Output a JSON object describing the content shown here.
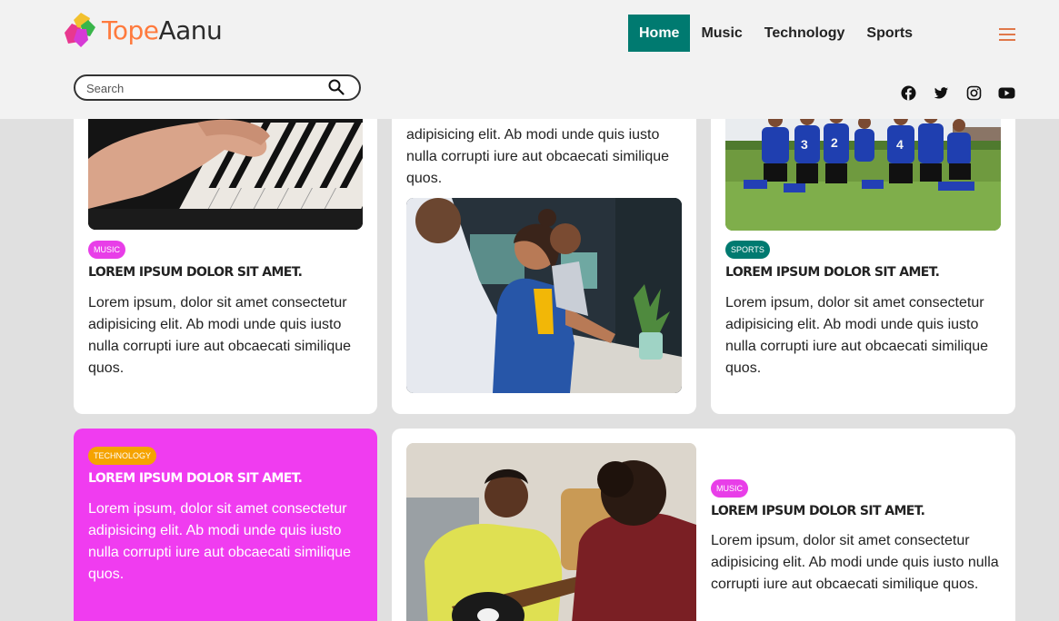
{
  "brand": {
    "name_part1": "Tope",
    "name_part2": "Aanu"
  },
  "nav": {
    "items": [
      "Home",
      "Music",
      "Technology",
      "Sports"
    ],
    "active": "Home"
  },
  "search": {
    "placeholder": "Search"
  },
  "social": [
    "facebook-icon",
    "twitter-icon",
    "instagram-icon",
    "youtube-icon"
  ],
  "colors": {
    "accent": "#007a70",
    "music_tag": "#e83ee8",
    "sports_tag": "#007a70",
    "technology_tag": "#f5a300",
    "highlight_card": "#f03cf0",
    "brand_orange": "#ff7a3d"
  },
  "cards": [
    {
      "tag": "Music",
      "title": "Lorem ipsum dolor sit amet.",
      "text": "Lorem ipsum, dolor sit amet consectetur adipisicing elit. Ab modi unde quis iusto nulla corrupti iure aut obcaecati similique quos.",
      "image": "piano-keys-photo"
    },
    {
      "text": "adipisicing elit. Ab modi unde quis iusto nulla corrupti iure aut obcaecati similique quos.",
      "image": "office-team-photo"
    },
    {
      "tag": "Sports",
      "title": "Lorem ipsum dolor sit amet.",
      "text": "Lorem ipsum, dolor sit amet consectetur adipisicing elit. Ab modi unde quis iusto nulla corrupti iure aut obcaecati similique quos.",
      "image": "football-team-photo"
    },
    {
      "tag": "Technology",
      "title": "Lorem ipsum dolor sit amet.",
      "text": "Lorem ipsum, dolor sit amet consectetur adipisicing elit. Ab modi unde quis iusto nulla corrupti iure aut obcaecati similique quos."
    },
    {
      "tag": "Music",
      "title": "Lorem ipsum dolor sit amet.",
      "text": "Lorem ipsum, dolor sit amet consectetur adipisicing elit. Ab modi unde quis iusto nulla corrupti iure aut obcaecati similique quos.",
      "image": "guitar-players-photo"
    }
  ]
}
